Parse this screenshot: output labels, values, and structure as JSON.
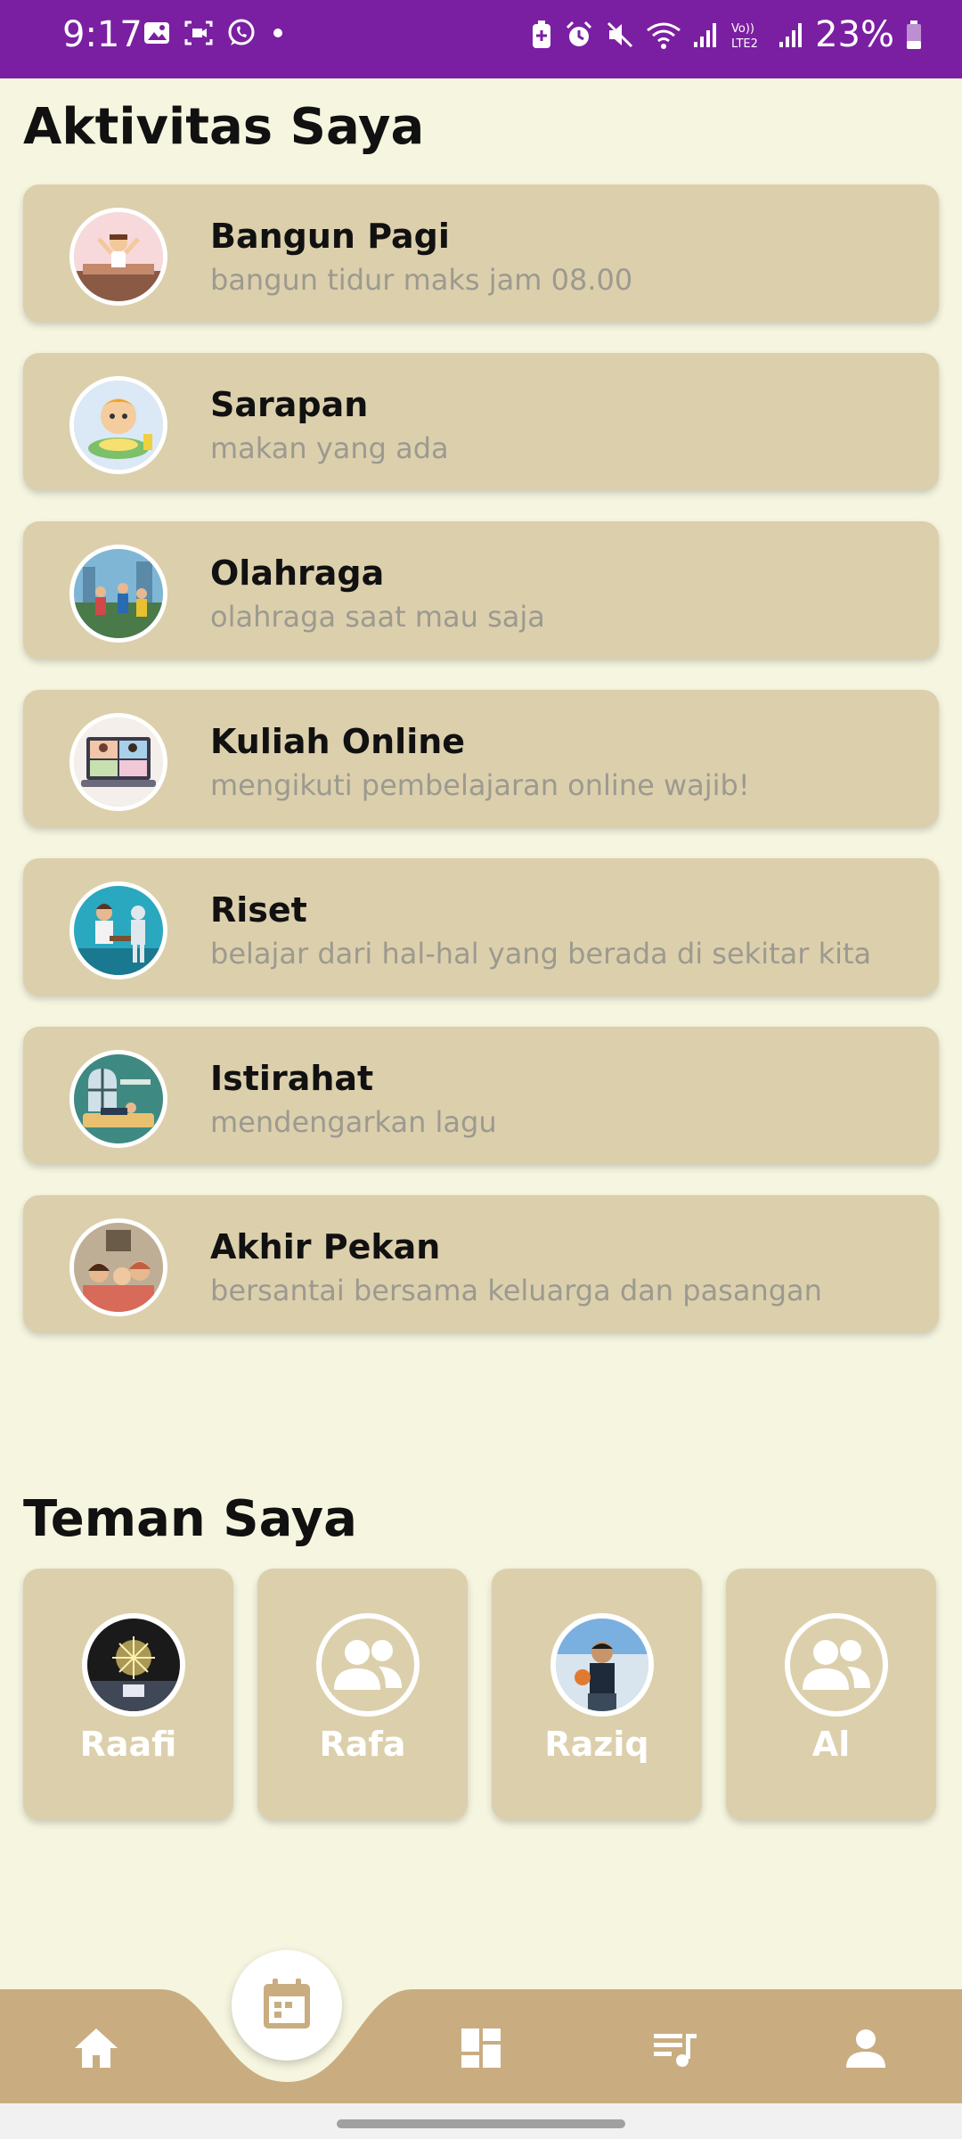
{
  "status_bar": {
    "time": "9:17",
    "battery": "23%",
    "left_icons": [
      "gallery-icon",
      "screen-record-icon",
      "whatsapp-icon",
      "dot-icon"
    ],
    "right_icons": [
      "battery-saver-icon",
      "alarm-icon",
      "mute-icon",
      "wifi-icon",
      "signal-icon",
      "volte-icon",
      "signal-icon",
      "battery-icon"
    ],
    "color": "#7b1fa2"
  },
  "activities_section": {
    "title": "Aktivitas Saya",
    "items": [
      {
        "title": "Bangun Pagi",
        "subtitle": "bangun tidur maks jam 08.00"
      },
      {
        "title": "Sarapan",
        "subtitle": "makan yang ada"
      },
      {
        "title": "Olahraga",
        "subtitle": "olahraga saat mau saja"
      },
      {
        "title": "Kuliah Online",
        "subtitle": "mengikuti pembelajaran online wajib!"
      },
      {
        "title": "Riset",
        "subtitle": "belajar dari hal-hal yang berada di sekitar kita"
      },
      {
        "title": "Istirahat",
        "subtitle": "mendengarkan lagu"
      },
      {
        "title": "Akhir Pekan",
        "subtitle": "bersantai bersama keluarga dan pasangan"
      }
    ]
  },
  "friends_section": {
    "title": "Teman Saya",
    "friends": [
      {
        "name": "Raafi"
      },
      {
        "name": "Rafa"
      },
      {
        "name": "Raziq"
      },
      {
        "name": "Al"
      }
    ]
  },
  "bottom_nav": {
    "items": [
      "home-icon",
      "calendar-icon",
      "dashboard-icon",
      "playlist-icon",
      "profile-icon"
    ],
    "active": "calendar-icon",
    "color": "#c9ad80"
  },
  "colors": {
    "background": "#f6f6e0",
    "card": "#dccfac",
    "subtitle": "#9c9a90"
  }
}
